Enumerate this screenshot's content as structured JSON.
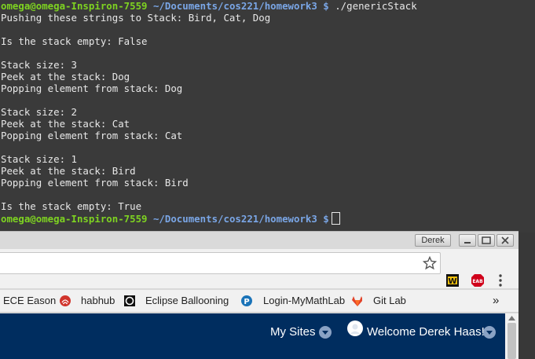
{
  "terminal": {
    "prompt_user": "omega@omega-Inspiron-7559",
    "prompt_path": "~/Documents/cos221/homework3 $",
    "command": " ./genericStack",
    "lines": [
      "Pushing these strings to Stack: Bird, Cat, Dog",
      "",
      "Is the stack empty: False",
      "",
      "Stack size: 3",
      "Peek at the stack: Dog",
      "Popping element from stack: Dog",
      "",
      "Stack size: 2",
      "Peek at the stack: Cat",
      "Popping element from stack: Cat",
      "",
      "Stack size: 1",
      "Peek at the stack: Bird",
      "Popping element from stack: Bird",
      "",
      "Is the stack empty: True"
    ]
  },
  "browser": {
    "profile_button": "Derek",
    "bookmarks": [
      {
        "label": "ECE Eason",
        "icon": "none"
      },
      {
        "label": "habhub",
        "icon": "habhub-icon"
      },
      {
        "label": "Eclipse Ballooning F",
        "icon": "eclipse-icon"
      },
      {
        "label": "Login-MyMathLab",
        "icon": "pearson-icon"
      },
      {
        "label": "Git Lab",
        "icon": "gitlab-icon"
      }
    ],
    "overflow_label": "»",
    "site_nav": {
      "my_sites": "My Sites",
      "welcome": "Welcome Derek Haas!"
    },
    "colors": {
      "site_header": "#002d5f",
      "prompt_user": "#7ed321",
      "prompt_path": "#7aa6e6"
    }
  }
}
